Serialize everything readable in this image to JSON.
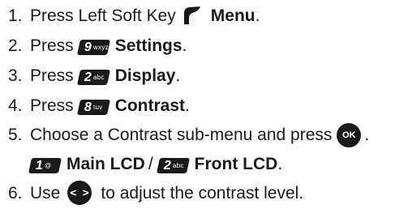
{
  "steps": [
    {
      "number": "1.",
      "text": "Press Left Soft Key",
      "icon": "left-soft-key-icon",
      "bold": "Menu",
      "suffix": "."
    },
    {
      "number": "2.",
      "text": "Press",
      "key": {
        "digit": "9",
        "letters": "wxyz"
      },
      "bold": "Settings",
      "suffix": "."
    },
    {
      "number": "3.",
      "text": "Press",
      "key": {
        "digit": "2",
        "letters": "abc"
      },
      "bold": "Display",
      "suffix": "."
    },
    {
      "number": "4.",
      "text": "Press",
      "key": {
        "digit": "8",
        "letters": "tuv"
      },
      "bold": "Contrast",
      "suffix": "."
    },
    {
      "number": "5.",
      "text": "Choose a Contrast sub-menu and press",
      "ok_label": "OK",
      "suffix": ".",
      "options": [
        {
          "key": {
            "digit": "1",
            "letters": "@"
          },
          "label": "Main LCD"
        },
        {
          "key": {
            "digit": "2",
            "letters": "abc"
          },
          "label": "Front LCD"
        }
      ],
      "separator": "/",
      "options_suffix": "."
    },
    {
      "number": "6.",
      "text_before": "Use",
      "icon": "navigation-key-icon",
      "text_after": "to adjust the contrast level."
    }
  ]
}
